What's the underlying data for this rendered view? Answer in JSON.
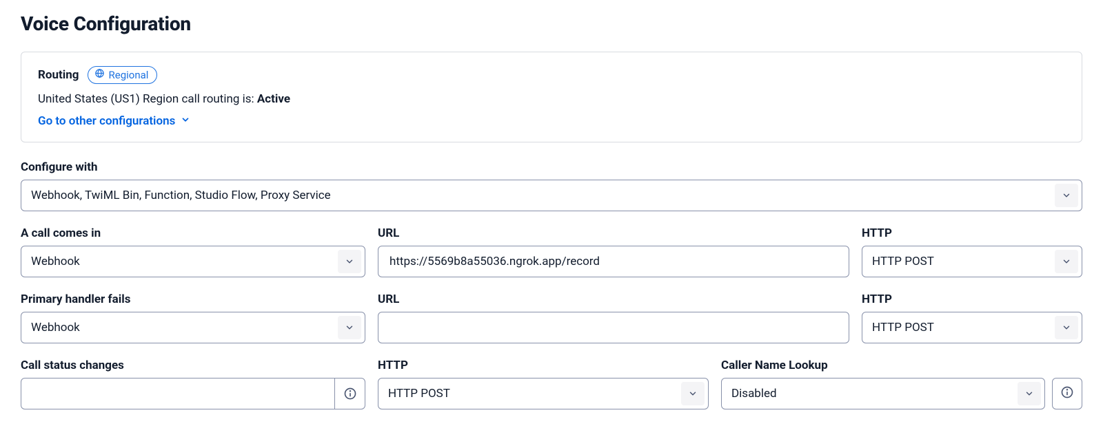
{
  "title": "Voice Configuration",
  "routing": {
    "label": "Routing",
    "pill": "Regional",
    "status_prefix": "United States (US1) Region call routing is: ",
    "status_value": "Active",
    "link": "Go to other configurations"
  },
  "configure_with": {
    "label": "Configure with",
    "value": "Webhook, TwiML Bin, Function, Studio Flow, Proxy Service"
  },
  "call_in": {
    "type_label": "A call comes in",
    "type_value": "Webhook",
    "url_label": "URL",
    "url_value": "https://5569b8a55036.ngrok.app/record",
    "http_label": "HTTP",
    "http_value": "HTTP POST"
  },
  "primary_fail": {
    "type_label": "Primary handler fails",
    "type_value": "Webhook",
    "url_label": "URL",
    "url_value": "",
    "http_label": "HTTP",
    "http_value": "HTTP POST"
  },
  "status_changes": {
    "label": "Call status changes",
    "url_value": "",
    "http_label": "HTTP",
    "http_value": "HTTP POST"
  },
  "caller_name": {
    "label": "Caller Name Lookup",
    "value": "Disabled"
  }
}
